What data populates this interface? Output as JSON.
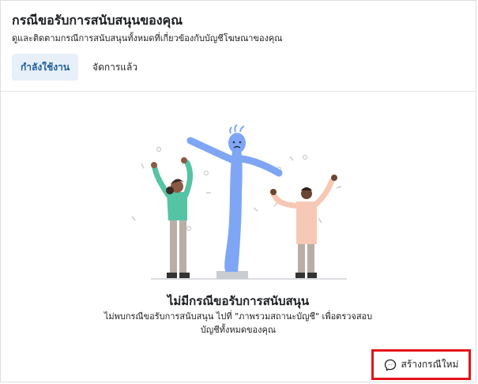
{
  "header": {
    "title": "กรณีขอรับการสนับสนุนของคุณ",
    "subtitle": "ดูและติดตามกรณีการสนับสนุนทั้งหมดที่เกี่ยวข้องกับบัญชีโฆษณาของคุณ",
    "tabs": [
      {
        "label": "กำลังใช้งาน",
        "active": true
      },
      {
        "label": "จัดการแล้ว",
        "active": false
      }
    ]
  },
  "empty_state": {
    "title": "ไม่มีกรณีขอรับการสนับสนุน",
    "line1": "ไม่พบกรณีขอรับการสนับสนุน ไปที่ \"ภาพรวมสถานะบัญชี\" เพื่อตรวจสอบ",
    "line2": "บัญชีทั้งหมดของคุณ"
  },
  "actions": {
    "create_label": "สร้างกรณีใหม่",
    "create_icon": "messenger-icon"
  },
  "colors": {
    "active_tab_bg": "#e7f0f9",
    "active_tab_text": "#1d5e96",
    "highlight_border": "#e3131c",
    "tube_blue": "#7fa6f4"
  }
}
